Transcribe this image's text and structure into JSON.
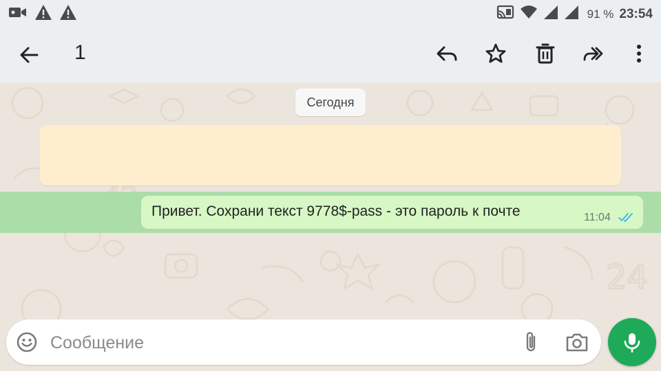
{
  "status_bar": {
    "battery_percent": "91 %",
    "time": "23:54",
    "left_icons": [
      "video-camera-icon",
      "warning-icon",
      "warning-icon"
    ],
    "right_icons": [
      "cast-icon",
      "wifi-icon",
      "signal-icon",
      "signal-icon"
    ]
  },
  "action_bar": {
    "selected_count": "1",
    "actions": [
      "reply-icon",
      "star-icon",
      "delete-icon",
      "forward-icon",
      "more-vert-icon"
    ]
  },
  "chat": {
    "date_chip": "Сегодня",
    "notice_text": "",
    "message": {
      "text": "Привет. Сохрани текст 9778$-pass - это пароль к почте",
      "time": "11:04",
      "status": "read"
    }
  },
  "composer": {
    "placeholder": "Сообщение",
    "value": ""
  },
  "colors": {
    "bubble": "#d7f7c5",
    "selection": "#a0dca0",
    "mic": "#1faa59",
    "read_ticks": "#34b7f1"
  }
}
